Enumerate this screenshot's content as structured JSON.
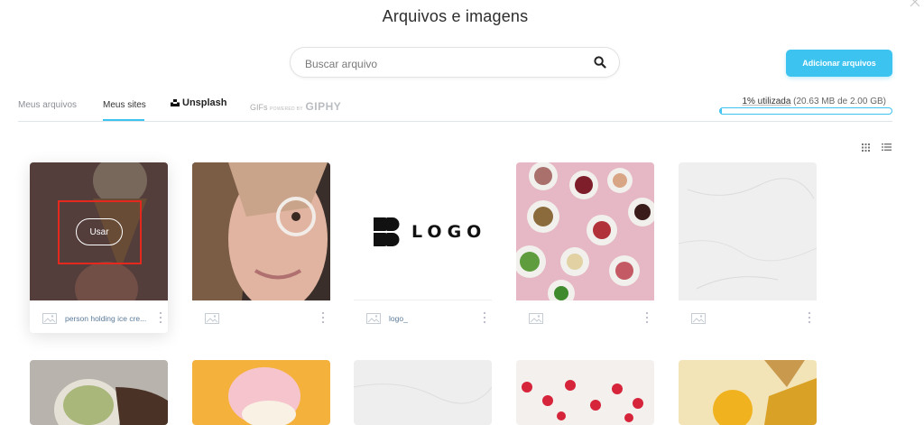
{
  "header": {
    "title": "Arquivos e imagens"
  },
  "search": {
    "placeholder": "Buscar arquivo",
    "value": ""
  },
  "actions": {
    "add_files_label": "Adicionar arquivos"
  },
  "tabs": [
    {
      "label": "Meus arquivos",
      "active": false
    },
    {
      "label": "Meus sites",
      "active": true
    },
    {
      "label": "Unsplash",
      "active": false
    },
    {
      "label": "GIFs",
      "powered_by": "POWERED BY",
      "brand": "GIPHY",
      "active": false
    }
  ],
  "storage": {
    "percent_label": "1% utilizada",
    "detail": "(20.63 MB de 2.00 GB)",
    "fraction": 0.01
  },
  "view_toggle": {
    "grid_icon": "grid-view-icon",
    "list_icon": "list-view-icon"
  },
  "files_row1": [
    {
      "name": "person holding ice cre...",
      "hovered": true,
      "use_label": "Usar"
    },
    {
      "name": ""
    },
    {
      "name": "logo_",
      "logo_text": "LOGO"
    },
    {
      "name": ""
    },
    {
      "name": ""
    }
  ],
  "colors": {
    "accent": "#3cc3f0",
    "highlight": "#e4281d",
    "file_name": "#5b7a99"
  }
}
